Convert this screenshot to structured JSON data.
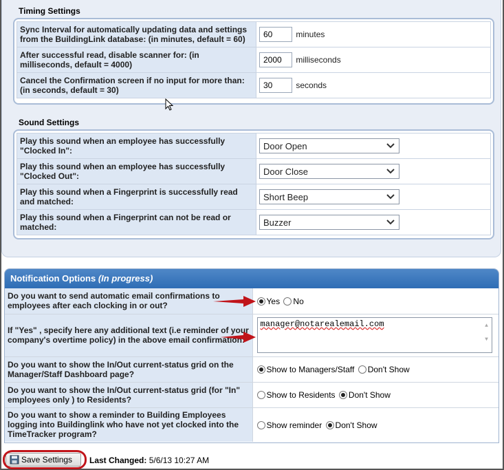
{
  "timing": {
    "title": "Timing Settings",
    "rows": [
      {
        "label": "Sync Interval for automatically updating data and settings from the BuildingLink database: (in minutes, default = 60)",
        "value": "60",
        "unit": "minutes"
      },
      {
        "label": "After successful read, disable scanner for: (in milliseconds, default = 4000)",
        "value": "2000",
        "unit": "milliseconds"
      },
      {
        "label": "Cancel the Confirmation screen if no input for more than: (in seconds, default = 30)",
        "value": "30",
        "unit": "seconds"
      }
    ]
  },
  "sound": {
    "title": "Sound Settings",
    "rows": [
      {
        "label": "Play this sound when an employee has successfully \"Clocked In\":",
        "value": "Door Open"
      },
      {
        "label": "Play this sound when an employee has successfully \"Clocked Out\":",
        "value": "Door Close"
      },
      {
        "label": "Play this sound when a Fingerprint is successfully read and matched:",
        "value": "Short Beep"
      },
      {
        "label": "Play this sound when a Fingerprint can not be read or matched:",
        "value": "Buzzer"
      }
    ]
  },
  "notification": {
    "title": "Notification Options",
    "title_note": "(In progress)",
    "rows": [
      {
        "label": "Do you want to send automatic email confirmations to employees after each clocking in or out?",
        "opt1": "Yes",
        "opt2": "No"
      },
      {
        "label": "If \"Yes\" , specify here any additional text (i.e reminder of your company's overtime policy) in the above email confirmation:",
        "text": "manager@notarealemail.com"
      },
      {
        "label": "Do you want to show the In/Out current-status grid on the Manager/Staff Dashboard page?",
        "opt1": "Show to Managers/Staff",
        "opt2": "Don't Show"
      },
      {
        "label": "Do you want to show the In/Out current-status grid (for \"In\" employees only ) to Residents?",
        "opt1": "Show to Residents",
        "opt2": "Don't Show"
      },
      {
        "label": "Do you want to show a reminder to Building Employees logging into Buildinglink who have not yet clocked into the TimeTracker program?",
        "opt1": "Show reminder",
        "opt2": "Don't Show"
      }
    ]
  },
  "footer": {
    "save_label": "Save Settings",
    "last_changed_label": "Last Changed:",
    "last_changed_value": "5/6/13 10:27 AM"
  },
  "colors": {
    "accent": "#2e6db5",
    "highlight_ring": "#c0141a",
    "arrow": "#c0141a"
  },
  "icons": {
    "save": "floppy-disk-icon",
    "select": "chevron-down-icon",
    "cursor": "mouse-pointer-icon",
    "arrow": "red-arrow-icon"
  }
}
